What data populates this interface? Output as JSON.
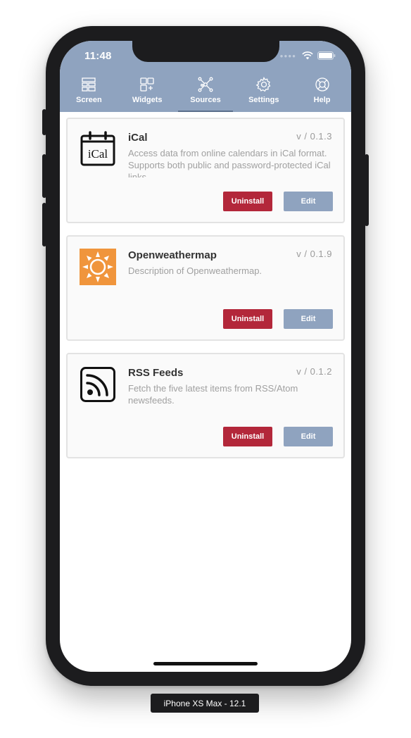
{
  "status_bar": {
    "time": "11:48"
  },
  "tabs": [
    {
      "label": "Screen",
      "icon": "screen-icon",
      "active": false
    },
    {
      "label": "Widgets",
      "icon": "widgets-icon",
      "active": false
    },
    {
      "label": "Sources",
      "icon": "sources-icon",
      "active": true
    },
    {
      "label": "Settings",
      "icon": "settings-icon",
      "active": false
    },
    {
      "label": "Help",
      "icon": "help-icon",
      "active": false
    }
  ],
  "sources": [
    {
      "name": "iCal",
      "version": "v / 0.1.3",
      "description": "Access data from online calendars in iCal format. Supports both public and password-protected iCal links.",
      "icon": "calendar-icon",
      "icon_text": "iCal",
      "uninstall_label": "Uninstall",
      "edit_label": "Edit"
    },
    {
      "name": "Openweathermap",
      "version": "v / 0.1.9",
      "description": "Description of Openweathermap.",
      "icon": "sun-icon",
      "uninstall_label": "Uninstall",
      "edit_label": "Edit"
    },
    {
      "name": "RSS Feeds",
      "version": "v / 0.1.2",
      "description": "Fetch the five latest items from RSS/Atom newsfeeds.",
      "icon": "rss-icon",
      "uninstall_label": "Uninstall",
      "edit_label": "Edit"
    }
  ],
  "device_label": "iPhone XS Max - 12.1",
  "colors": {
    "nav": "#8fa3bf",
    "uninstall": "#b3273a",
    "edit": "#8fa3bf",
    "sun": "#f0953c"
  }
}
